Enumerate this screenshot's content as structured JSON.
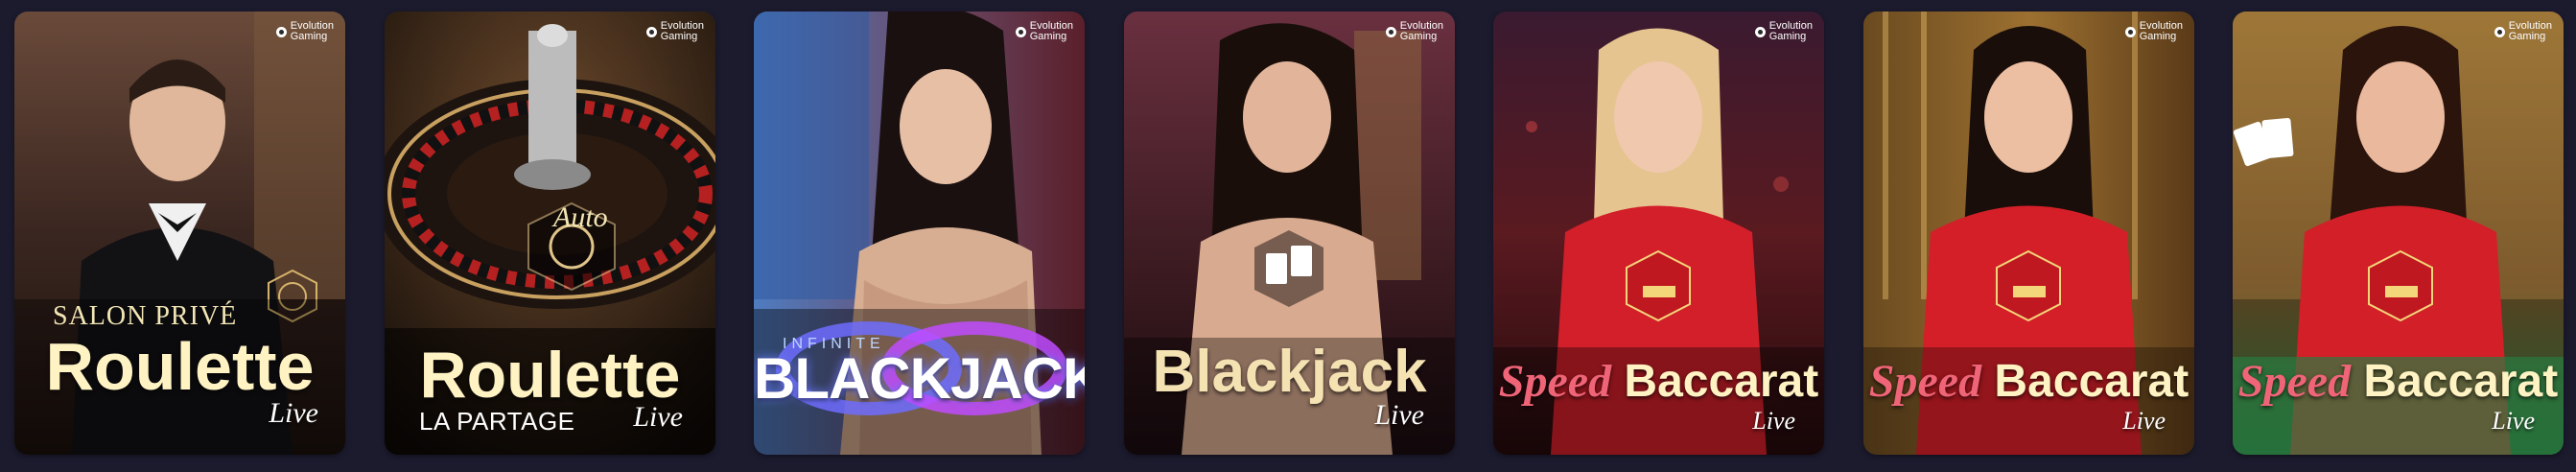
{
  "provider": {
    "line1": "Evolution",
    "line2": "Gaming"
  },
  "tiles": [
    {
      "top": "SALON PRIVÉ",
      "title": "Roulette",
      "live": "Live"
    },
    {
      "top": "Auto",
      "title": "Roulette",
      "sub": "LA PARTAGE",
      "live": "Live"
    },
    {
      "top": "INFINITE",
      "title": "BLACKJACK"
    },
    {
      "title": "Blackjack",
      "live": "Live"
    },
    {
      "speed": "Speed",
      "title": "Baccarat",
      "live": "Live"
    },
    {
      "speed": "Speed",
      "title": "Baccarat",
      "live": "Live"
    },
    {
      "speed": "Speed",
      "title": "Baccarat",
      "live": "Live"
    }
  ]
}
